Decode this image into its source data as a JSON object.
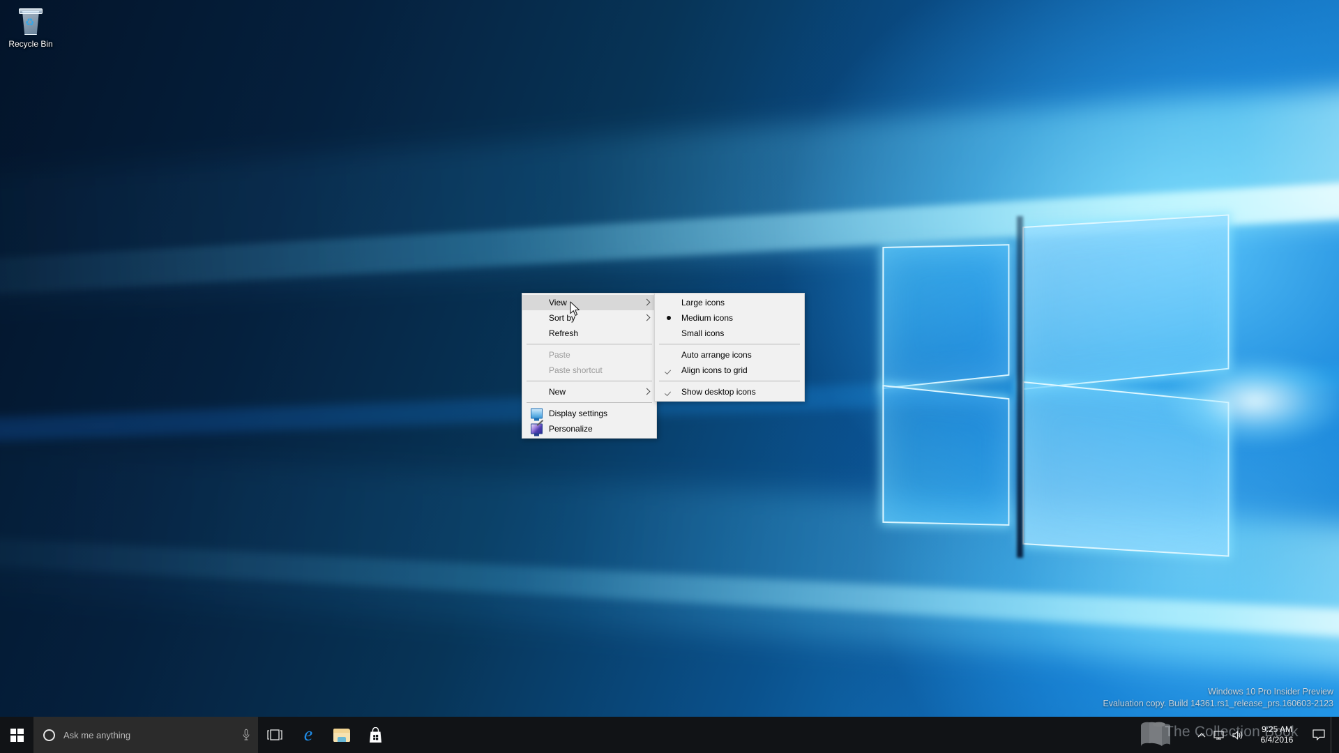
{
  "desktop": {
    "icons": [
      {
        "label": "Recycle Bin",
        "icon": "recycle-bin-icon"
      }
    ]
  },
  "context_menu": {
    "items": [
      {
        "label": "View",
        "type": "submenu",
        "disabled": false,
        "highlighted": true,
        "icon": ""
      },
      {
        "label": "Sort by",
        "type": "submenu",
        "disabled": false,
        "highlighted": false,
        "icon": ""
      },
      {
        "label": "Refresh",
        "type": "item",
        "disabled": false,
        "highlighted": false,
        "icon": ""
      },
      {
        "label": "Paste",
        "type": "item",
        "disabled": true,
        "highlighted": false,
        "icon": ""
      },
      {
        "label": "Paste shortcut",
        "type": "item",
        "disabled": true,
        "highlighted": false,
        "icon": ""
      },
      {
        "label": "New",
        "type": "submenu",
        "disabled": false,
        "highlighted": false,
        "icon": ""
      },
      {
        "label": "Display settings",
        "type": "item",
        "disabled": false,
        "highlighted": false,
        "icon": "display-monitor-icon"
      },
      {
        "label": "Personalize",
        "type": "item",
        "disabled": false,
        "highlighted": false,
        "icon": "personalize-monitor-icon"
      }
    ]
  },
  "view_submenu": {
    "items": [
      {
        "label": "Large icons",
        "marker": "none"
      },
      {
        "label": "Medium icons",
        "marker": "radio"
      },
      {
        "label": "Small icons",
        "marker": "none"
      },
      {
        "label": "Auto arrange icons",
        "marker": "none"
      },
      {
        "label": "Align icons to grid",
        "marker": "check"
      },
      {
        "label": "Show desktop icons",
        "marker": "check"
      }
    ]
  },
  "watermark": {
    "line1": "Windows 10 Pro Insider Preview",
    "line2": "Evaluation copy. Build 14361.rs1_release_prs.160603-2123"
  },
  "overlay": {
    "text": "The Collection Book",
    "icon": "book-icon"
  },
  "taskbar": {
    "start": {
      "label": "Start",
      "icon": "windows-logo-icon"
    },
    "search": {
      "placeholder": "Ask me anything",
      "cortana_icon": "cortana-circle-icon",
      "mic_icon": "microphone-icon"
    },
    "buttons": [
      {
        "label": "Task View",
        "icon": "task-view-icon"
      },
      {
        "label": "Microsoft Edge",
        "icon": "edge-icon"
      },
      {
        "label": "File Explorer",
        "icon": "folder-icon"
      },
      {
        "label": "Microsoft Store",
        "icon": "store-bag-icon"
      }
    ],
    "tray": {
      "icons": [
        {
          "label": "Show hidden icons",
          "icon": "chevron-up-icon"
        },
        {
          "label": "Network",
          "icon": "network-monitor-icon"
        },
        {
          "label": "Volume",
          "icon": "speaker-icon"
        }
      ],
      "clock": {
        "time": "9:25 AM",
        "date": "6/4/2016"
      },
      "action_center": {
        "label": "Action Center",
        "icon": "notification-icon"
      },
      "show_desktop": {
        "label": "Show desktop"
      }
    }
  },
  "colors": {
    "taskbar_bg": "#111316",
    "search_bg": "#2b2b2b",
    "menu_bg": "#f1f1f1",
    "menu_highlight": "#d8d8d8",
    "menu_border": "#d4d4d4",
    "menu_disabled_text": "#9a9a9a",
    "accent_blue": "#1f8ce8",
    "wallpaper_dark": "#03142a",
    "wallpaper_light": "#27a0ef"
  }
}
